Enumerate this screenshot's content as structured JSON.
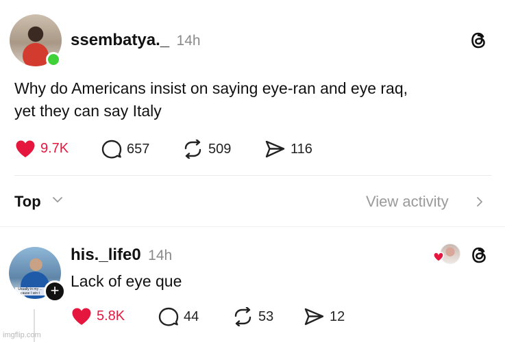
{
  "post": {
    "username": "ssembatya._",
    "time": "14h",
    "text_line1": "Why do Americans insist on saying eye-ran and eye raq,",
    "text_line2": "yet they can say Italy",
    "likes": "9.7K",
    "comments": "657",
    "reposts": "509",
    "shares": "116"
  },
  "sort": {
    "label": "Top",
    "view_activity": "View activity"
  },
  "reply": {
    "username": "his._life0",
    "time": "14h",
    "text": "Lack of eye que",
    "avatar_caption": "Usually in my ... cause I win t",
    "likes": "5.8K",
    "comments": "44",
    "reposts": "53",
    "shares": "12"
  },
  "watermark": "imgflip.com",
  "colors": {
    "like_red": "#e5173f",
    "online_green": "#3fd03a",
    "muted_gray": "#8a8a8a"
  },
  "icons": [
    "threads-icon",
    "heart-icon",
    "comment-icon",
    "repost-icon",
    "share-icon",
    "chevron-down-icon",
    "chevron-right-icon",
    "plus-icon"
  ]
}
